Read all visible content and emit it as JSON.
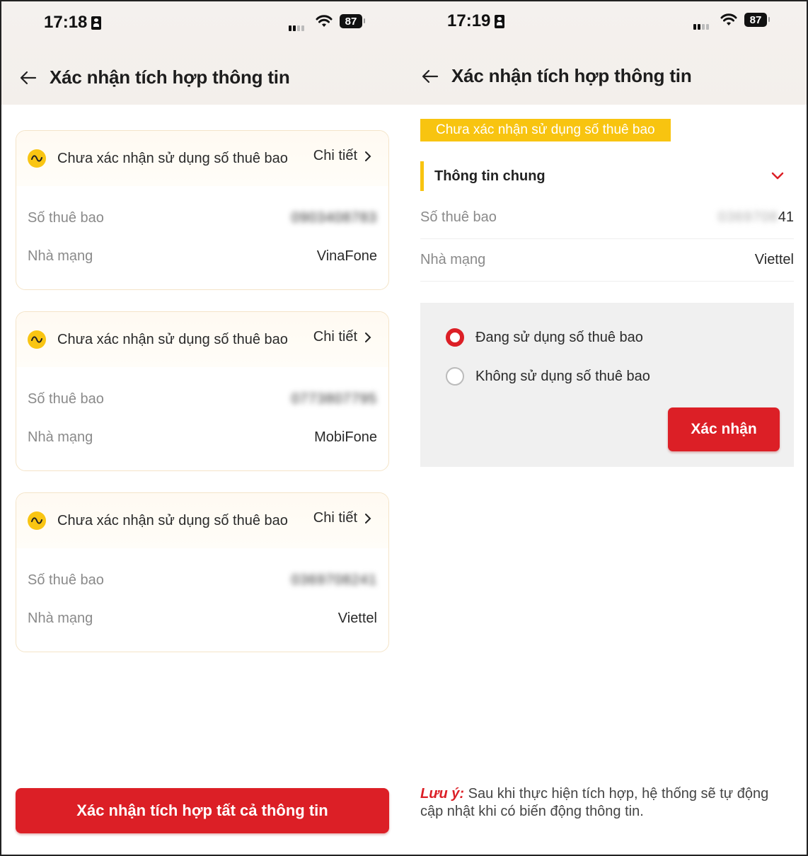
{
  "left": {
    "status_bar": {
      "time": "17:18",
      "battery": "87"
    },
    "header": {
      "title": "Xác nhận tích hợp thông tin"
    },
    "cards": [
      {
        "status": "Chưa xác nhận sử dụng số thuê bao",
        "detail_label": "Chi tiết",
        "subscriber_label": "Số thuê bao",
        "subscriber_value": "0903408783",
        "carrier_label": "Nhà mạng",
        "carrier_value": "VinaFone"
      },
      {
        "status": "Chưa xác nhận sử dụng số thuê bao",
        "detail_label": "Chi tiết",
        "subscriber_label": "Số thuê bao",
        "subscriber_value": "0773807795",
        "carrier_label": "Nhà mạng",
        "carrier_value": "MobiFone"
      },
      {
        "status": "Chưa xác nhận sử dụng số thuê bao",
        "detail_label": "Chi tiết",
        "subscriber_label": "Số thuê bao",
        "subscriber_value": "0369708241",
        "carrier_label": "Nhà mạng",
        "carrier_value": "Viettel"
      }
    ],
    "bottom_button": "Xác nhận tích hợp tất cả thông tin"
  },
  "right": {
    "status_bar": {
      "time": "17:19",
      "battery": "87"
    },
    "header": {
      "title": "Xác nhận tích hợp thông tin"
    },
    "status_tag": "Chưa xác nhận sử dụng số thuê bao",
    "section_title": "Thông tin chung",
    "subscriber_label": "Số thuê bao",
    "subscriber_value_blurred": "0369708",
    "subscriber_value_tail": "41",
    "carrier_label": "Nhà mạng",
    "carrier_value": "Viettel",
    "options": [
      {
        "label": "Đang sử dụng số thuê bao",
        "selected": true
      },
      {
        "label": "Không sử dụng số thuê bao",
        "selected": false
      }
    ],
    "confirm_button": "Xác nhận",
    "note_label": "Lưu ý:",
    "note_text": " Sau khi thực hiện tích hợp, hệ thống sẽ tự động cập nhật khi có biến động thông tin."
  },
  "colors": {
    "brand_red": "#dc1f26",
    "warning_yellow": "#f8c410"
  }
}
